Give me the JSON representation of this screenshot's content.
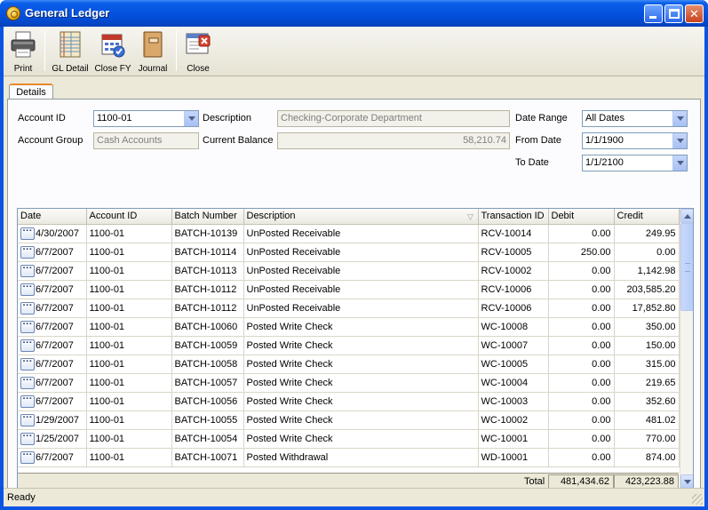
{
  "window": {
    "title": "General Ledger"
  },
  "toolbar": {
    "items": [
      {
        "label": "Print",
        "icon": "printer-icon"
      },
      {
        "label": "GL Detail",
        "icon": "ledger-icon"
      },
      {
        "label": "Close FY",
        "icon": "calendar-icon"
      },
      {
        "label": "Journal",
        "icon": "journal-icon"
      },
      {
        "label": "Close",
        "icon": "close-window-icon"
      }
    ]
  },
  "tabs": [
    {
      "label": "Details",
      "active": true
    }
  ],
  "form": {
    "account_id_label": "Account ID",
    "account_id_value": "1100-01",
    "account_group_label": "Account Group",
    "account_group_value": "Cash Accounts",
    "description_label": "Description",
    "description_value": "Checking-Corporate Department",
    "current_balance_label": "Current Balance",
    "current_balance_value": "58,210.74",
    "date_range_label": "Date Range",
    "date_range_value": "All Dates",
    "from_date_label": "From Date",
    "from_date_value": "1/1/1900",
    "to_date_label": "To Date",
    "to_date_value": "1/1/2100"
  },
  "grid": {
    "columns": [
      "Date",
      "Account ID",
      "Batch Number",
      "Description",
      "Transaction ID",
      "Debit",
      "Credit"
    ],
    "rows": [
      [
        "4/30/2007",
        "1100-01",
        "BATCH-10139",
        "UnPosted Receivable",
        "RCV-10014",
        "0.00",
        "249.95"
      ],
      [
        "6/7/2007",
        "1100-01",
        "BATCH-10114",
        "UnPosted Receivable",
        "RCV-10005",
        "250.00",
        "0.00"
      ],
      [
        "6/7/2007",
        "1100-01",
        "BATCH-10113",
        "UnPosted Receivable",
        "RCV-10002",
        "0.00",
        "1,142.98"
      ],
      [
        "6/7/2007",
        "1100-01",
        "BATCH-10112",
        "UnPosted Receivable",
        "RCV-10006",
        "0.00",
        "203,585.20"
      ],
      [
        "6/7/2007",
        "1100-01",
        "BATCH-10112",
        "UnPosted Receivable",
        "RCV-10006",
        "0.00",
        "17,852.80"
      ],
      [
        "6/7/2007",
        "1100-01",
        "BATCH-10060",
        "Posted Write Check",
        "WC-10008",
        "0.00",
        "350.00"
      ],
      [
        "6/7/2007",
        "1100-01",
        "BATCH-10059",
        "Posted Write Check",
        "WC-10007",
        "0.00",
        "150.00"
      ],
      [
        "6/7/2007",
        "1100-01",
        "BATCH-10058",
        "Posted Write Check",
        "WC-10005",
        "0.00",
        "315.00"
      ],
      [
        "6/7/2007",
        "1100-01",
        "BATCH-10057",
        "Posted Write Check",
        "WC-10004",
        "0.00",
        "219.65"
      ],
      [
        "6/7/2007",
        "1100-01",
        "BATCH-10056",
        "Posted Write Check",
        "WC-10003",
        "0.00",
        "352.60"
      ],
      [
        "1/29/2007",
        "1100-01",
        "BATCH-10055",
        "Posted Write Check",
        "WC-10002",
        "0.00",
        "481.02"
      ],
      [
        "1/25/2007",
        "1100-01",
        "BATCH-10054",
        "Posted Write Check",
        "WC-10001",
        "0.00",
        "770.00"
      ],
      [
        "6/7/2007",
        "1100-01",
        "BATCH-10071",
        "Posted Withdrawal",
        "WD-10001",
        "0.00",
        "874.00"
      ]
    ],
    "totals_label": "Total",
    "total_debit": "481,434.62",
    "total_credit": "423,223.88"
  },
  "status": {
    "text": "Ready"
  }
}
